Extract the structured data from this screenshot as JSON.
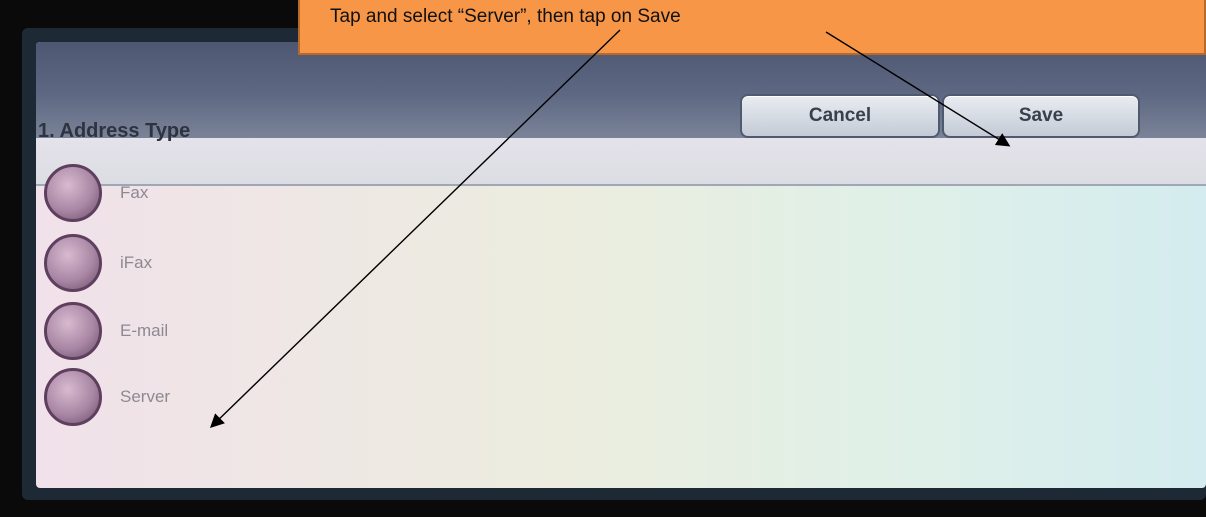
{
  "callout": {
    "text": "Tap and select “Server”, then tap on Save"
  },
  "panel": {
    "title": "1. Address Type",
    "cancel_label": "Cancel",
    "save_label": "Save"
  },
  "address_types": [
    {
      "label": "Fax"
    },
    {
      "label": "iFax"
    },
    {
      "label": "E-mail"
    },
    {
      "label": "Server"
    }
  ],
  "colors": {
    "callout_bg": "#f79646",
    "header_band": "#5e6883",
    "radio": "#a987a5"
  },
  "icons": {
    "radio": "radio-button-icon",
    "arrow": "arrow-icon"
  }
}
